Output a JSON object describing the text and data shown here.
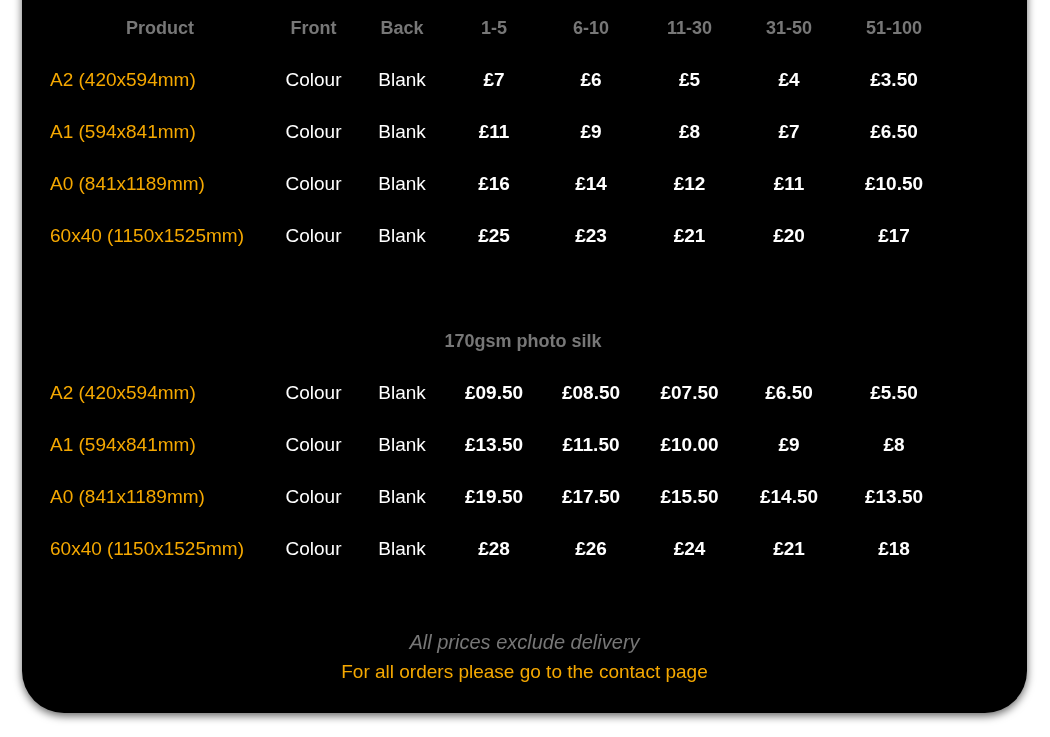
{
  "table": {
    "columns": [
      "Product",
      "Front",
      "Back",
      "1-5",
      "6-10",
      "11-30",
      "31-50",
      "51-100"
    ],
    "sections": [
      {
        "rows": [
          {
            "product": "A2 (420x594mm)",
            "front": "Colour",
            "back": "Blank",
            "prices": [
              "£7",
              "£6",
              "£5",
              "£4",
              "£3.50"
            ]
          },
          {
            "product": "A1 (594x841mm)",
            "front": "Colour",
            "back": "Blank",
            "prices": [
              "£11",
              "£9",
              "£8",
              "£7",
              "£6.50"
            ]
          },
          {
            "product": "A0 (841x1189mm)",
            "front": "Colour",
            "back": "Blank",
            "prices": [
              "£16",
              "£14",
              "£12",
              "£11",
              "£10.50"
            ]
          },
          {
            "product": "60x40 (1150x1525mm)",
            "front": "Colour",
            "back": "Blank",
            "prices": [
              "£25",
              "£23",
              "£21",
              "£20",
              "£17"
            ]
          }
        ]
      },
      {
        "title": "170gsm photo silk",
        "rows": [
          {
            "product": "A2 (420x594mm)",
            "front": "Colour",
            "back": "Blank",
            "prices": [
              "£09.50",
              "£08.50",
              "£07.50",
              "£6.50",
              "£5.50"
            ]
          },
          {
            "product": "A1 (594x841mm)",
            "front": "Colour",
            "back": "Blank",
            "prices": [
              "£13.50",
              "£11.50",
              "£10.00",
              "£9",
              "£8"
            ]
          },
          {
            "product": "A0 (841x1189mm)",
            "front": "Colour",
            "back": "Blank",
            "prices": [
              "£19.50",
              "£17.50",
              "£15.50",
              "£14.50",
              "£13.50"
            ]
          },
          {
            "product": "60x40 (1150x1525mm)",
            "front": "Colour",
            "back": "Blank",
            "prices": [
              "£28",
              "£26",
              "£24",
              "£21",
              "£18"
            ]
          }
        ]
      }
    ]
  },
  "footer": {
    "note": "All prices exclude delivery",
    "link": "For all orders please go to the contact page"
  }
}
